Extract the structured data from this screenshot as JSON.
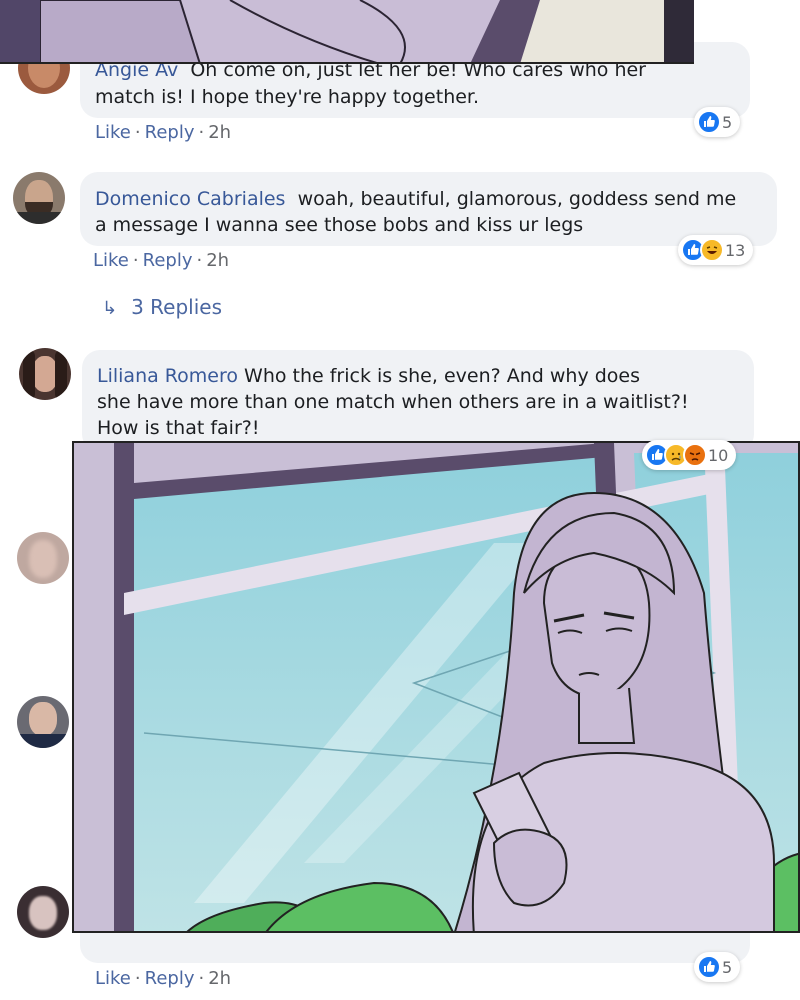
{
  "colors": {
    "author": "#385898",
    "link": "#4b67a1",
    "bubble": "#f0f2f5",
    "like_blue": "#1877f2",
    "panel_sky": "#8fd0dc",
    "character_lilac": "#c8bcd4"
  },
  "comments": [
    {
      "author": "Angie Av",
      "text_lines": [
        "Oh come on, just let her be! Who cares who her",
        "match is! I hope they're happy together."
      ],
      "actions": {
        "like": "Like",
        "reply": "Reply",
        "time": "2h"
      },
      "reactions": {
        "icons": [
          "like-icon"
        ],
        "count": "5"
      }
    },
    {
      "author": "Domenico Cabriales",
      "text_lines": [
        "woah, beautiful, glamorous, goddess send me",
        "a message I wanna see those bobs and kiss ur legs"
      ],
      "actions": {
        "like": "Like",
        "reply": "Reply",
        "time": "2h"
      },
      "reactions": {
        "icons": [
          "like-icon",
          "laugh-icon"
        ],
        "count": "13"
      },
      "replies_label": "3 Replies"
    },
    {
      "author": "Liliana Romero",
      "text_lines": [
        "Who the frick is she, even? And why does",
        "she have more than one match when others are in a waitlist?!",
        "How is that fair?!"
      ],
      "reactions": {
        "icons": [
          "like-icon",
          "sad-icon",
          "angry-icon"
        ],
        "count": "10"
      }
    },
    {
      "actions": {
        "like": "Like",
        "reply": "Reply",
        "time": "2h"
      },
      "reactions": {
        "icons": [
          "like-icon"
        ],
        "count": "5"
      }
    }
  ]
}
